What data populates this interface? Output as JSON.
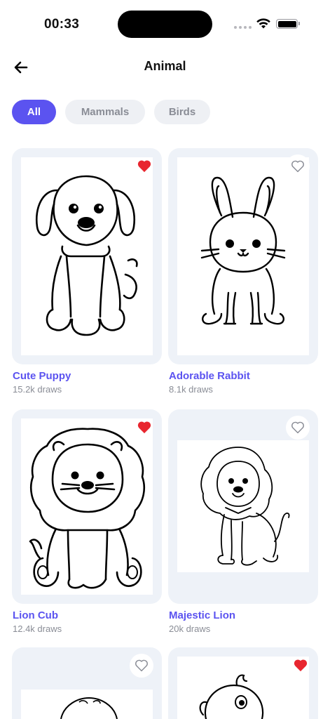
{
  "status_bar": {
    "time": "00:33"
  },
  "header": {
    "title": "Animal"
  },
  "filters": [
    {
      "label": "All",
      "active": true
    },
    {
      "label": "Mammals",
      "active": false
    },
    {
      "label": "Birds",
      "active": false
    }
  ],
  "cards": [
    {
      "name": "Cute Puppy",
      "draws": "15.2k draws",
      "favorited": true
    },
    {
      "name": "Adorable Rabbit",
      "draws": "8.1k draws",
      "favorited": false
    },
    {
      "name": "Lion Cub",
      "draws": "12.4k draws",
      "favorited": true
    },
    {
      "name": "Majestic Lion",
      "draws": "20k draws",
      "favorited": false
    },
    {
      "name": "",
      "draws": "",
      "favorited": false
    },
    {
      "name": "",
      "draws": "",
      "favorited": true
    }
  ],
  "colors": {
    "accent": "#5b53f0",
    "heart": "#e8262f",
    "chip_bg": "#eef0f4",
    "card_bg": "#eef2f8"
  },
  "icons": {
    "back": "arrow-left-icon",
    "heart_filled": "heart-filled-icon",
    "heart_outline": "heart-outline-icon"
  }
}
